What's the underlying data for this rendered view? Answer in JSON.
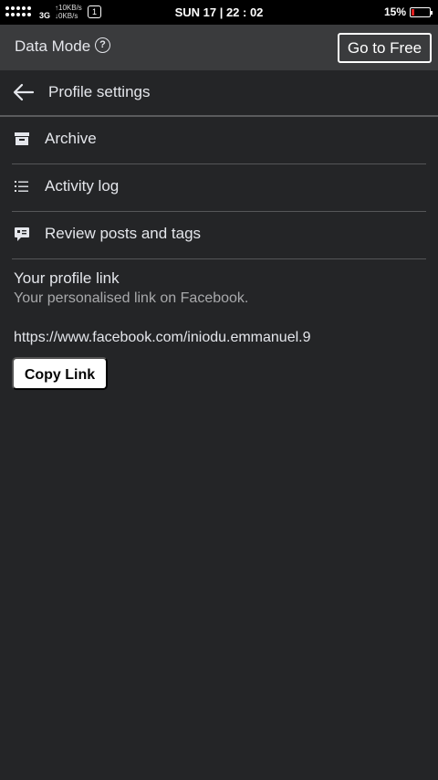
{
  "status_bar": {
    "network_type": "3G",
    "upload_speed": "10KB/s",
    "download_speed": "0KB/s",
    "sim_slot": "1",
    "clock": "SUN 17 | 22 : 02",
    "battery_percent": "15%",
    "battery_level": 0.15,
    "battery_color": "#e02020"
  },
  "data_header": {
    "label": "Data Mode",
    "help_icon": "question-circle-icon",
    "button_label": "Go to Free"
  },
  "header": {
    "back_icon": "arrow-left-icon",
    "title": "Profile settings"
  },
  "menu": [
    {
      "label": "Archive",
      "icon": "archive-box-icon"
    },
    {
      "label": "Activity log",
      "icon": "list-icon"
    },
    {
      "label": "Review posts and tags",
      "icon": "comment-tag-icon"
    }
  ],
  "profile_link": {
    "title": "Your profile link",
    "subtitle": "Your personalised link on Facebook.",
    "url": "https://www.facebook.com/iniodu.emmanuel.9",
    "copy_label": "Copy Link"
  },
  "colors": {
    "background": "#242527",
    "header": "#3a3b3d",
    "text": "#e4e6eb",
    "muted_text": "#a8a9ab"
  }
}
